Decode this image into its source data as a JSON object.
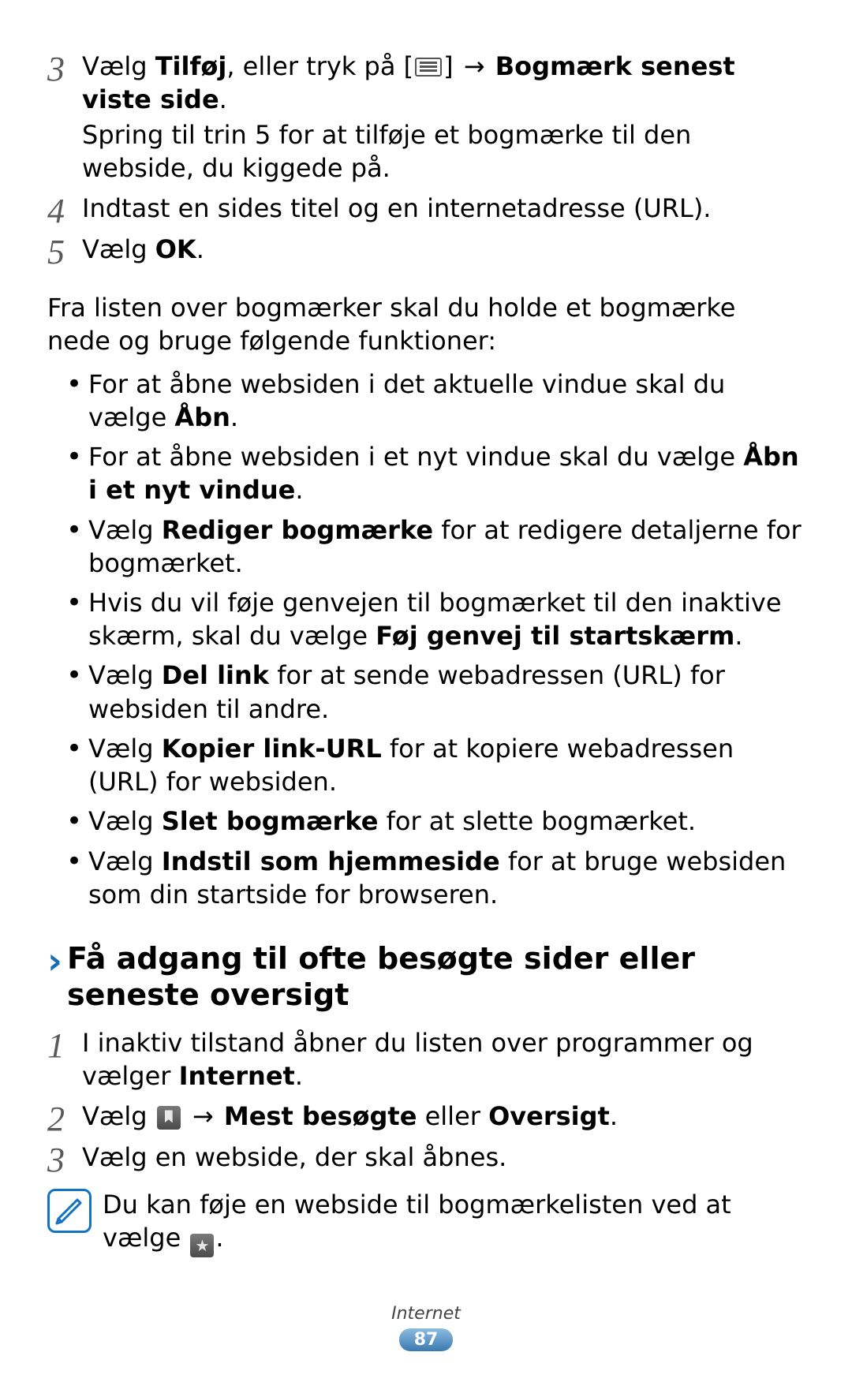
{
  "stepsA": [
    {
      "num": "3",
      "line1_pre": "Vælg ",
      "line1_bold1": "Tilføj",
      "line1_mid": ", eller tryk på [",
      "line1_arrow": " → ",
      "line1_bold2": "Bogmærk senest viste side",
      "line1_post": ".",
      "line2": "Spring til trin 5 for at tilføje et bogmærke til den webside, du kiggede på."
    },
    {
      "num": "4",
      "line": "Indtast en sides titel og en internetadresse (URL)."
    },
    {
      "num": "5",
      "line_pre": "Vælg ",
      "line_bold": "OK",
      "line_post": "."
    }
  ],
  "intro_para": "Fra listen over bogmærker skal du holde et bogmærke nede og bruge følgende funktioner:",
  "bullets": [
    {
      "pre": "For at åbne websiden i det aktuelle vindue skal du vælge ",
      "bold": "Åbn",
      "post": "."
    },
    {
      "pre": "For at åbne websiden i et nyt vindue skal du vælge ",
      "bold": "Åbn i et nyt vindue",
      "post": "."
    },
    {
      "pre": "Vælg ",
      "bold": "Rediger bogmærke",
      "post": " for at redigere detaljerne for bogmærket."
    },
    {
      "pre": "Hvis du vil føje genvejen til bogmærket til den inaktive skærm, skal du vælge ",
      "bold": "Føj genvej til startskærm",
      "post": "."
    },
    {
      "pre": "Vælg ",
      "bold": "Del link",
      "post": " for at sende webadressen (URL) for websiden til andre."
    },
    {
      "pre": "Vælg ",
      "bold": "Kopier link-URL",
      "post": " for at kopiere webadressen (URL) for websiden."
    },
    {
      "pre": "Vælg ",
      "bold": "Slet bogmærke",
      "post": " for at slette bogmærket."
    },
    {
      "pre": "Vælg ",
      "bold": "Indstil som hjemmeside",
      "post": " for at bruge websiden som din startside for browseren."
    }
  ],
  "section": {
    "chevron": "›",
    "title": "Få adgang til ofte besøgte sider eller seneste oversigt"
  },
  "stepsB": [
    {
      "num": "1",
      "pre": "I inaktiv tilstand åbner du listen over programmer og vælger ",
      "bold": "Internet",
      "post": "."
    },
    {
      "num": "2",
      "pre": "Vælg ",
      "arrow": " → ",
      "bold1": "Mest besøgte",
      "mid": " eller ",
      "bold2": "Oversigt",
      "post": "."
    },
    {
      "num": "3",
      "text": "Vælg en webside, der skal åbnes."
    }
  ],
  "note": {
    "pre": "Du kan føje en webside til bogmærkelisten ved at vælge ",
    "post": "."
  },
  "footer": {
    "chapter": "Internet",
    "page": "87"
  }
}
